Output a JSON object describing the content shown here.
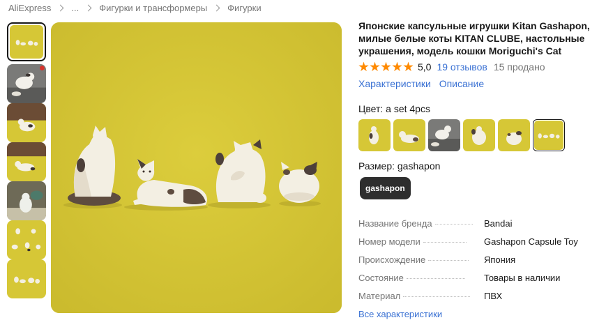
{
  "breadcrumb": {
    "items": [
      "AliExpress",
      "...",
      "Фигурки и трансформеры",
      "Фигурки"
    ]
  },
  "gallery": {
    "thumbnail_count": 7,
    "selected_index": 0
  },
  "product": {
    "title": "Японские капсульные игрушки Kitan Gashapon, милые белые коты KITAN CLUBE, настольные украшения, модель кошки Moriguchi's Cat",
    "rating": {
      "stars": 5,
      "value": "5,0",
      "reviews": "19 отзывов",
      "sold": "15 продано"
    },
    "links": {
      "characteristics": "Характеристики",
      "description": "Описание"
    },
    "color": {
      "label": "Цвет: a set 4pcs",
      "swatch_count": 6,
      "selected_index": 5
    },
    "size": {
      "label": "Размер: gashapon",
      "option": "gashapon"
    },
    "specs": [
      {
        "key": "Название бренда",
        "value": "Bandai"
      },
      {
        "key": "Номер модели",
        "value": "Gashapon Capsule Toy"
      },
      {
        "key": "Происхождение",
        "value": "Япония"
      },
      {
        "key": "Состояние",
        "value": "Товары в наличии"
      },
      {
        "key": "Материал",
        "value": "ПВХ"
      }
    ],
    "all_specs_link": "Все характеристики"
  },
  "colors": {
    "accent_link": "#3a71d3",
    "star": "#ff8a00",
    "image_background": "#d6c736",
    "size_button": "#2e2e2e"
  }
}
